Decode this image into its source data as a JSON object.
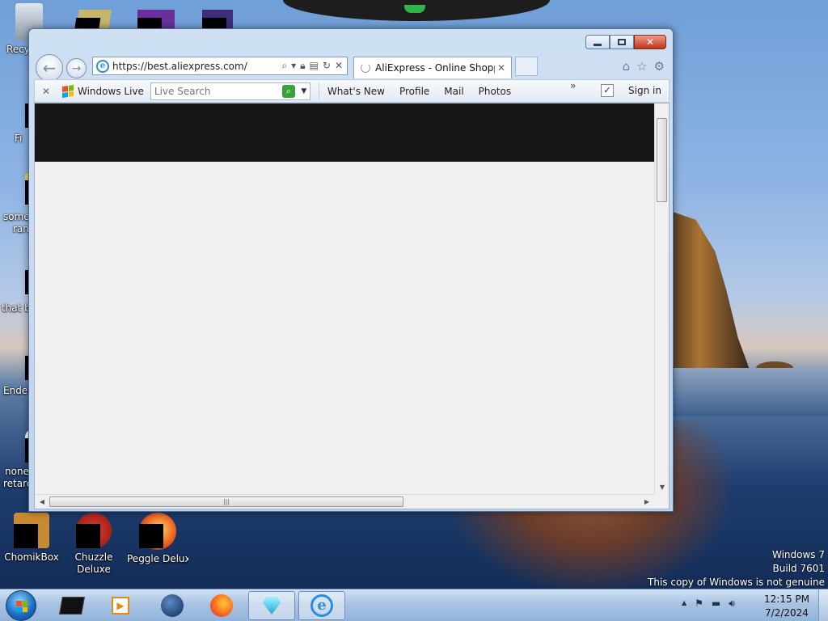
{
  "desktop": {
    "icons": [
      {
        "label": "Recy"
      },
      {
        "label": "Fi"
      },
      {
        "label": "some"
      },
      {
        "label": "ran"
      },
      {
        "label": "that b"
      },
      {
        "label": "Ender"
      },
      {
        "label": "none"
      },
      {
        "label": "retarc"
      },
      {
        "label": "ChomikBox"
      },
      {
        "label": "Chuzzle Deluxe"
      },
      {
        "label": "Peggle Deluxe"
      }
    ],
    "watermark": {
      "line1": "Windows 7",
      "line2": "Build 7601",
      "line3": "This copy of Windows is not genuine"
    }
  },
  "browser": {
    "address": {
      "url": "https://best.aliexpress.com/"
    },
    "tab": {
      "title": "AliExpress - Online Shoppi...",
      "close": "✕"
    },
    "toolbar": {
      "close": "✕",
      "windows_live": "Windows Live",
      "search_placeholder": "Live Search",
      "links": [
        "What's New",
        "Profile",
        "Mail",
        "Photos"
      ],
      "more": "»",
      "sign_in": "Sign in"
    },
    "page": {
      "header_color": "#171717",
      "background": "#f1f1f1"
    }
  },
  "taskbar": {
    "clock_time": "12:15 PM",
    "clock_date": "7/2/2024",
    "tray_arrow": "▲"
  },
  "colors": {
    "accent": "#2a8de0",
    "close_button": "#c1331c"
  }
}
